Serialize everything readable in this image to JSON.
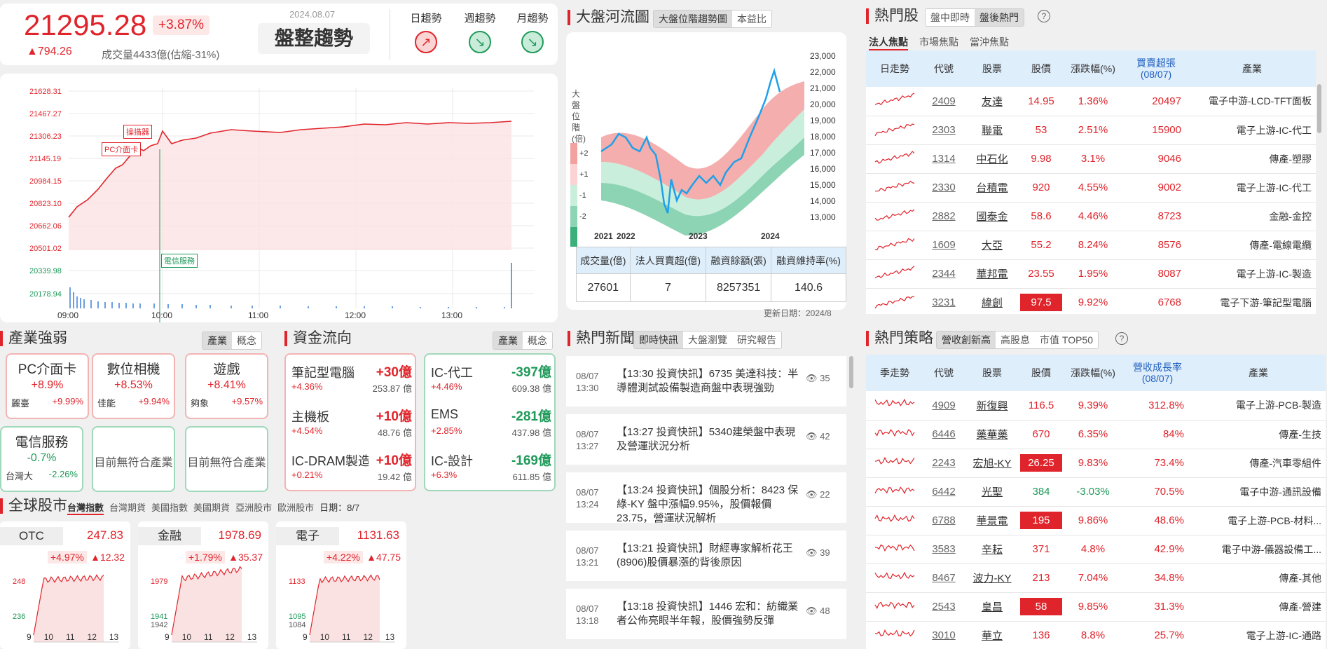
{
  "index": {
    "value": "21295.28",
    "pct": "+3.87%",
    "change": "▲794.26",
    "volume": "成交量4433億(估縮-31%)",
    "date": "2024.08.07",
    "trend_label": "盤整趨勢"
  },
  "trends": [
    {
      "label": "日趨勢",
      "dir": "up"
    },
    {
      "label": "週趨勢",
      "dir": "down"
    },
    {
      "label": "月趨勢",
      "dir": "down"
    }
  ],
  "intraday": {
    "y_ticks": [
      "21628.31",
      "21467.27",
      "21306.23",
      "21145.19",
      "20984.15",
      "20823.10",
      "20662.06",
      "20501.02"
    ],
    "vol_ticks": [
      "20339.98",
      "20178.94"
    ],
    "x_ticks": [
      "09:00",
      "10:00",
      "11:00",
      "12:00",
      "13:00"
    ],
    "annotations": [
      "操描器",
      "PC介面卡",
      "電信服務"
    ]
  },
  "river": {
    "title": "大盤河流圖",
    "tabs": [
      "大盤位階趨勢圖",
      "本益比"
    ],
    "ylabel": "大盤位階(倍)",
    "legend": [
      "+2",
      "+1",
      "-1",
      "-2"
    ],
    "y_ticks": [
      "23,000",
      "22,000",
      "21,000",
      "20,000",
      "19,000",
      "18,000",
      "17,000",
      "16,000",
      "15,000",
      "14,000",
      "13,000"
    ],
    "x_ticks": [
      "2021",
      "2022",
      "2023",
      "2024"
    ],
    "table_headers": [
      "成交量(億)",
      "法人買賣超(億)",
      "融資餘額(張)",
      "融資維持率(%)"
    ],
    "table_values": [
      "27601",
      "7",
      "8257351",
      "140.6"
    ],
    "updated": "更新日期：2024/8"
  },
  "hot": {
    "title": "熱門股",
    "tabs": [
      "盤中即時",
      "盤後熱門"
    ],
    "sub_tabs": [
      "法人焦點",
      "市場焦點",
      "當沖焦點"
    ],
    "headers": [
      "日走勢",
      "代號",
      "股票",
      "股價",
      "漲跌幅(%)",
      "買賣超張\n(08/07)",
      "產業"
    ],
    "rows": [
      {
        "code": "2409",
        "name": "友達",
        "price": "14.95",
        "pct": "1.36%",
        "vol": "20497",
        "ind": "電子中游-LCD-TFT面板",
        "limit": false
      },
      {
        "code": "2303",
        "name": "聯電",
        "price": "53",
        "pct": "2.51%",
        "vol": "15900",
        "ind": "電子上游-IC-代工",
        "limit": false
      },
      {
        "code": "1314",
        "name": "中石化",
        "price": "9.98",
        "pct": "3.1%",
        "vol": "9046",
        "ind": "傳產-塑膠",
        "limit": false
      },
      {
        "code": "2330",
        "name": "台積電",
        "price": "920",
        "pct": "4.55%",
        "vol": "9002",
        "ind": "電子上游-IC-代工",
        "limit": false
      },
      {
        "code": "2882",
        "name": "國泰金",
        "price": "58.6",
        "pct": "4.46%",
        "vol": "8723",
        "ind": "金融-金控",
        "limit": false
      },
      {
        "code": "1609",
        "name": "大亞",
        "price": "55.2",
        "pct": "8.24%",
        "vol": "8576",
        "ind": "傳產-電線電纜",
        "limit": false
      },
      {
        "code": "2344",
        "name": "華邦電",
        "price": "23.55",
        "pct": "1.95%",
        "vol": "8087",
        "ind": "電子上游-IC-製造",
        "limit": false
      },
      {
        "code": "3231",
        "name": "緯創",
        "price": "97.5",
        "pct": "9.92%",
        "vol": "6768",
        "ind": "電子下游-筆記型電腦",
        "limit": true
      }
    ]
  },
  "industry": {
    "title": "產業強弱",
    "tabs": [
      "產業",
      "概念"
    ],
    "cards": [
      {
        "name": "PC介面卡",
        "pct": "+8.9%",
        "stock": "麗臺",
        "spct": "+9.99%",
        "c": "r"
      },
      {
        "name": "數位相機",
        "pct": "+8.53%",
        "stock": "佳能",
        "spct": "+9.94%",
        "c": "r"
      },
      {
        "name": "遊戲",
        "pct": "+8.41%",
        "stock": "夠象",
        "spct": "+9.57%",
        "c": "r"
      },
      {
        "name": "電信服務",
        "pct": "-0.7%",
        "stock": "台灣大",
        "spct": "-2.26%",
        "c": "g"
      },
      {
        "empty": "目前無符合產業",
        "c": "g"
      },
      {
        "empty": "目前無符合產業",
        "c": "g"
      }
    ]
  },
  "capital": {
    "title": "資金流向",
    "tabs": [
      "產業",
      "概念"
    ],
    "inflow": [
      {
        "name": "筆記型電腦",
        "amt": "+30億",
        "pct": "+4.36%",
        "val": "253.87 億"
      },
      {
        "name": "主機板",
        "amt": "+10億",
        "pct": "+4.54%",
        "val": "48.76 億"
      },
      {
        "name": "IC-DRAM製造",
        "amt": "+10億",
        "pct": "+0.21%",
        "val": "19.42 億"
      }
    ],
    "outflow": [
      {
        "name": "IC-代工",
        "amt": "-397億",
        "pct": "+4.46%",
        "val": "609.38 億"
      },
      {
        "name": "EMS",
        "amt": "-281億",
        "pct": "+2.85%",
        "val": "437.98 億"
      },
      {
        "name": "IC-設計",
        "amt": "-169億",
        "pct": "+6.3%",
        "val": "611.85 億"
      }
    ]
  },
  "global": {
    "title": "全球股市",
    "tabs": [
      "台灣指數",
      "台灣期貨",
      "美國指數",
      "美國期貨",
      "亞洲股市",
      "歐洲股市"
    ],
    "date": "日期：8/7",
    "cards": [
      {
        "name": "OTC",
        "value": "247.83",
        "pct": "+4.97%",
        "chg": "▲12.32",
        "hi": "248",
        "lo": "236",
        "lo2": ""
      },
      {
        "name": "金融",
        "value": "1978.69",
        "pct": "+1.79%",
        "chg": "▲35.37",
        "hi": "1979",
        "lo": "1941",
        "lo2": "1942"
      },
      {
        "name": "電子",
        "value": "1131.63",
        "pct": "+4.22%",
        "chg": "▲47.75",
        "hi": "1133",
        "lo": "1095",
        "lo2": "1084"
      }
    ],
    "x_ticks": [
      "9",
      "10",
      "11",
      "12",
      "13"
    ]
  },
  "news": {
    "title": "熱門新聞",
    "tabs": [
      "即時快訊",
      "大盤瀏覽",
      "研究報告"
    ],
    "items": [
      {
        "date": "08/07",
        "time": "13:30",
        "text": "【13:30 投資快訊】6735 美達科技：半導體測試設備製造商盤中表現強勁",
        "views": "35"
      },
      {
        "date": "08/07",
        "time": "13:27",
        "text": "【13:27 投資快訊】5340建榮盤中表現及營運狀況分析",
        "views": "42"
      },
      {
        "date": "08/07",
        "time": "13:24",
        "text": "【13:24 投資快訊】個股分析：8423 保綠-KY 盤中漲幅9.95%，股價報價23.75，營運狀況解析",
        "views": "22"
      },
      {
        "date": "08/07",
        "time": "13:21",
        "text": "【13:21 投資快訊】財經專家解析花王(8906)股價暴漲的背後原因",
        "views": "39"
      },
      {
        "date": "08/07",
        "time": "13:18",
        "text": "【13:18 投資快訊】1446 宏和：紡織業者公佈亮眼半年報，股價強勢反彈",
        "views": "48"
      }
    ]
  },
  "strategy": {
    "title": "熱門策略",
    "tabs": [
      "營收創新高",
      "高股息",
      "市值 TOP50"
    ],
    "headers": [
      "季走勢",
      "代號",
      "股票",
      "股價",
      "漲跌幅(%)",
      "營收成長率\n(08/07)",
      "產業"
    ],
    "rows": [
      {
        "code": "4909",
        "name": "新復興",
        "price": "116.5",
        "pct": "9.39%",
        "vol": "312.8%",
        "ind": "電子上游-PCB-製造",
        "limit": false,
        "neg": false
      },
      {
        "code": "6446",
        "name": "藥華藥",
        "price": "670",
        "pct": "6.35%",
        "vol": "84%",
        "ind": "傳產-生技",
        "limit": false,
        "neg": false
      },
      {
        "code": "2243",
        "name": "宏旭-KY",
        "price": "26.25",
        "pct": "9.83%",
        "vol": "73.4%",
        "ind": "傳產-汽車零組件",
        "limit": true,
        "neg": false
      },
      {
        "code": "6442",
        "name": "光聖",
        "price": "384",
        "pct": "-3.03%",
        "vol": "70.5%",
        "ind": "電子中游-通訊設備",
        "limit": false,
        "neg": true
      },
      {
        "code": "6788",
        "name": "華景電",
        "price": "195",
        "pct": "9.86%",
        "vol": "48.6%",
        "ind": "電子上游-PCB-材料...",
        "limit": true,
        "neg": false
      },
      {
        "code": "3583",
        "name": "辛耘",
        "price": "371",
        "pct": "4.8%",
        "vol": "42.9%",
        "ind": "電子中游-儀器設備工...",
        "limit": false,
        "neg": false
      },
      {
        "code": "8467",
        "name": "波力-KY",
        "price": "213",
        "pct": "7.04%",
        "vol": "34.8%",
        "ind": "傳產-其他",
        "limit": false,
        "neg": false
      },
      {
        "code": "2543",
        "name": "皇昌",
        "price": "58",
        "pct": "9.85%",
        "vol": "31.3%",
        "ind": "傳產-營建",
        "limit": true,
        "neg": false
      },
      {
        "code": "3010",
        "name": "華立",
        "price": "136",
        "pct": "8.8%",
        "vol": "25.7%",
        "ind": "電子上游-IC-通路",
        "limit": false,
        "neg": false
      }
    ]
  },
  "colors": {
    "up": "#e0242b",
    "down": "#1f9a5a",
    "header_bg": "#dfeefb"
  }
}
